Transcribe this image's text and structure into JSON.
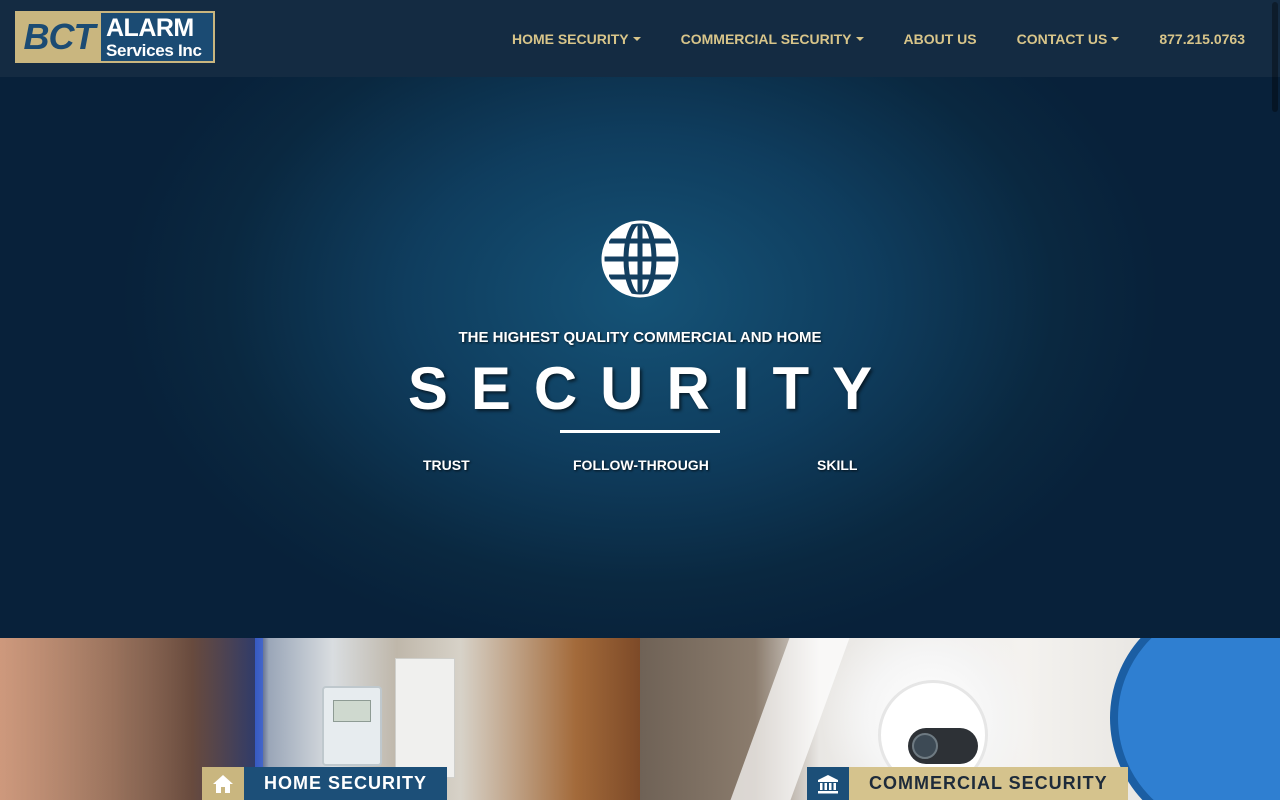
{
  "brand": {
    "logo_left": "BCT",
    "logo_line1": "ALARM",
    "logo_line2": "Services Inc"
  },
  "nav": {
    "items": [
      {
        "label": "HOME SECURITY",
        "has_dropdown": true
      },
      {
        "label": "COMMERCIAL SECURITY",
        "has_dropdown": true
      },
      {
        "label": "ABOUT US",
        "has_dropdown": false
      },
      {
        "label": "CONTACT US",
        "has_dropdown": true
      }
    ],
    "phone": "877.215.0763"
  },
  "hero": {
    "icon": "globe-icon",
    "subtitle": "THE HIGHEST QUALITY COMMERCIAL AND HOME",
    "title": "SECURITY",
    "values": [
      "TRUST",
      "FOLLOW-THROUGH",
      "SKILL"
    ]
  },
  "panels": {
    "home": {
      "label": "HOME SECURITY",
      "icon": "home-icon"
    },
    "commercial": {
      "label": "COMMERCIAL SECURITY",
      "icon": "bank-icon"
    }
  },
  "colors": {
    "navbar": "#142b42",
    "gold": "#d8c58a",
    "hero_center": "#155377",
    "hero_edge": "#08213a",
    "brand_blue": "#1c4f78"
  }
}
